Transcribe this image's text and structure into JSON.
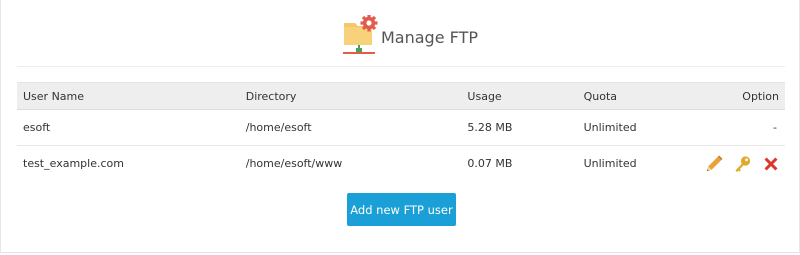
{
  "page": {
    "title": "Manage FTP"
  },
  "table": {
    "headers": {
      "user": "User Name",
      "directory": "Directory",
      "usage": "Usage",
      "quota": "Quota",
      "option": "Option"
    },
    "rows": [
      {
        "user": "esoft",
        "directory": "/home/esoft",
        "usage": "5.28 MB",
        "quota": "Unlimited",
        "option": "-"
      },
      {
        "user": "test_example.com",
        "directory": "/home/esoft/www",
        "usage": "0.07 MB",
        "quota": "Unlimited",
        "actions": [
          "edit-icon",
          "key-icon",
          "delete-icon"
        ]
      }
    ]
  },
  "add_button": {
    "label": "Add new FTP user"
  },
  "colors": {
    "primary_button": "#1b9fd7",
    "quota_text": "#2e6b2e",
    "edit_icon": "#e8a23a",
    "key_icon": "#d9a020",
    "delete_icon": "#d9382b"
  }
}
